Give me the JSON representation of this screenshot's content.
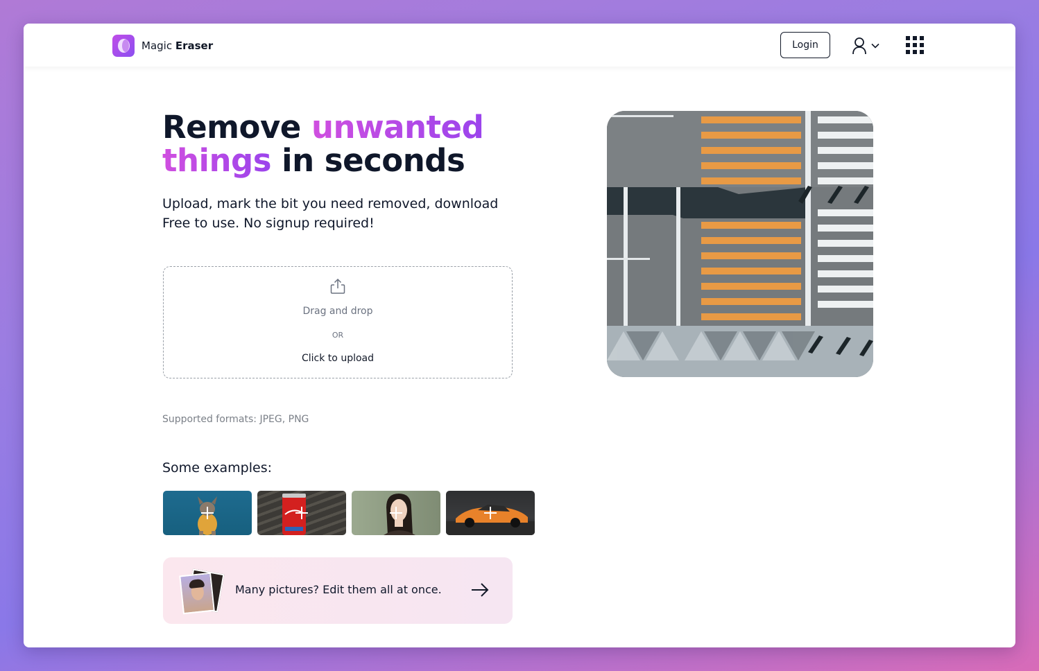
{
  "navbar": {
    "brand": {
      "prefix": "Magic",
      "suffix": "Eraser"
    },
    "login_label": "Login",
    "icons": {
      "user": "user-icon",
      "chevron": "chevron-down-icon",
      "apps": "apps-grid-icon"
    }
  },
  "hero": {
    "headline": {
      "part1": "Remove ",
      "accent1": "unwanted",
      "accent2": "things",
      "part2": " in seconds"
    },
    "subtitle_line1": "Upload, mark the bit you need removed, download",
    "subtitle_line2": "Free to use. No signup required!",
    "image": "crosswalk-aerial-photo"
  },
  "upload": {
    "icon": "upload-icon",
    "drag_text": "Drag and drop",
    "or_text": "OR",
    "click_text": "Click to upload",
    "formats": "Supported formats: JPEG, PNG"
  },
  "examples": {
    "title": "Some examples:",
    "items": [
      {
        "subject": "dog-in-yellow-shirt"
      },
      {
        "subject": "coca-cola-can"
      },
      {
        "subject": "woman-portrait"
      },
      {
        "subject": "orange-sports-car"
      }
    ]
  },
  "batch": {
    "text": "Many pictures? Edit them all at once.",
    "icon": "arrow-right-icon"
  },
  "colors": {
    "accent_start": "#d04fe0",
    "accent_end": "#9b44ec",
    "text_dark": "#0f172a",
    "card_bg": "#fbe7ee"
  }
}
